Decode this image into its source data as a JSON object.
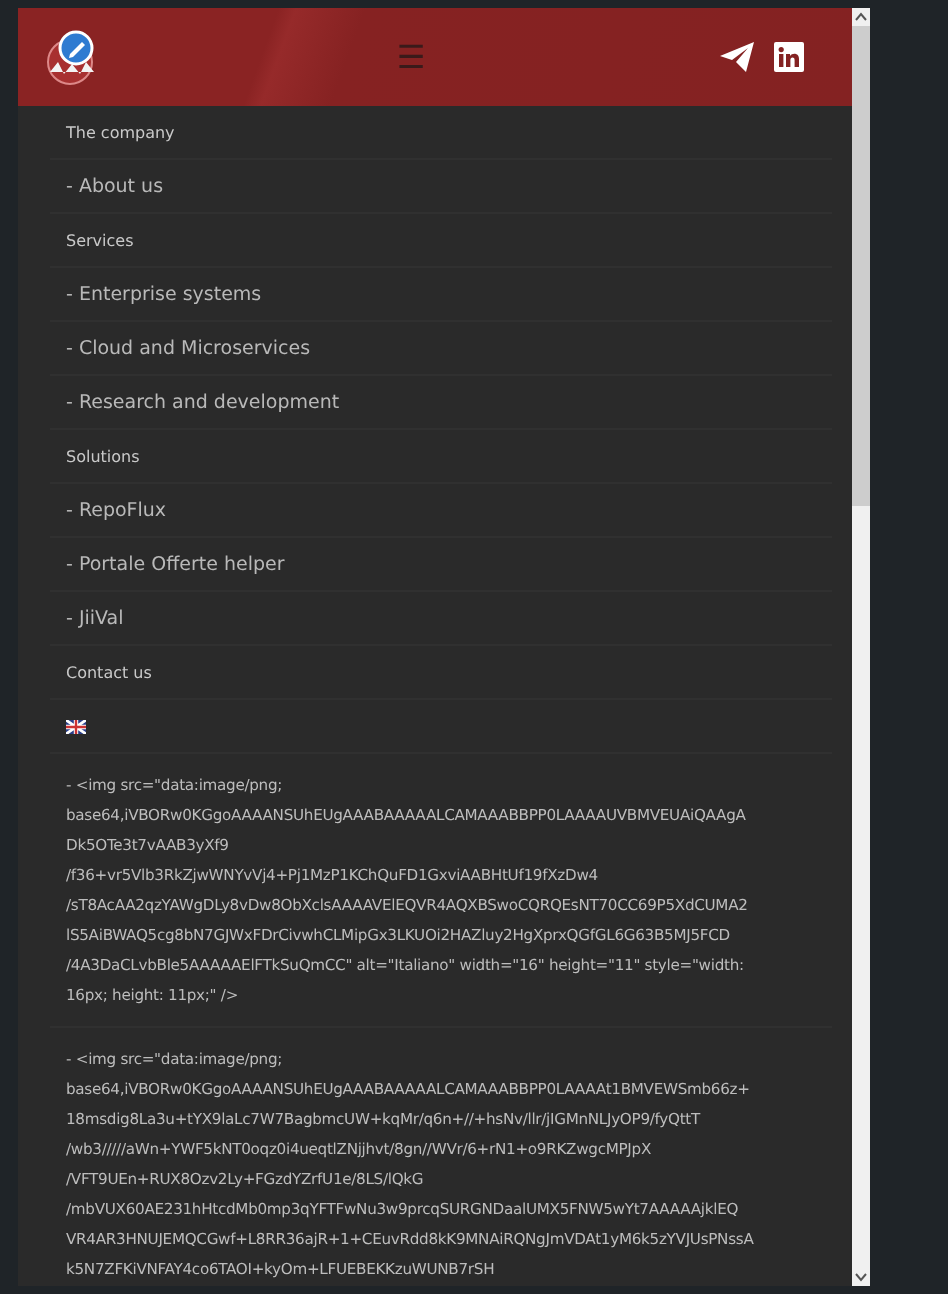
{
  "header": {
    "menu_icon": "☰"
  },
  "menu": [
    {
      "kind": "heading",
      "label": "The company"
    },
    {
      "kind": "link",
      "label": "- About us"
    },
    {
      "kind": "heading",
      "label": "Services"
    },
    {
      "kind": "link",
      "label": "- Enterprise systems"
    },
    {
      "kind": "link",
      "label": "- Cloud and Microservices"
    },
    {
      "kind": "link",
      "label": "- Research and development"
    },
    {
      "kind": "heading",
      "label": "Solutions"
    },
    {
      "kind": "link",
      "label": "- RepoFlux"
    },
    {
      "kind": "link",
      "label": "- Portale Offerte helper"
    },
    {
      "kind": "link",
      "label": "- JiiVal"
    },
    {
      "kind": "heading",
      "label": "Contact us"
    },
    {
      "kind": "flag"
    },
    {
      "kind": "code",
      "lines": [
        "- <img src=\"data:image/png;",
        "base64,iVBORw0KGgoAAAANSUhEUgAAABAAAAALCAMAAABBPP0LAAAAUVBMVEUAiQAAgA",
        "Dk5OTe3t7vAAB3yXf9",
        "/f36+vr5Vlb3RkZjwWNYvVj4+Pj1MzP1KChQuFD1GxviAABHtUf19fXzDw4",
        "/sT8AcAA2qzYAWgDLy8vDw8ObXclsAAAAVElEQVR4AQXBSwoCQRQEsNT70CC69P5XdCUMA2",
        "lS5AiBWAQ5cg8bN7GJWxFDrCivwhCLMipGx3LKUOi2HAZluy2HgXprxQGfGL6G63B5MJ5FCD",
        "/4A3DaCLvbBle5AAAAAElFTkSuQmCC\" alt=\"Italiano\" width=\"16\" height=\"11\" style=\"width:",
        "16px; height: 11px;\" />"
      ]
    },
    {
      "kind": "code",
      "lines": [
        "- <img src=\"data:image/png;",
        "base64,iVBORw0KGgoAAAANSUhEUgAAABAAAAALCAMAAABBPP0LAAAAt1BMVEWSmb66z+",
        "18msdig8La3u+tYX9laLc7W7BagbmcUW+kqMr/q6n+//+hsNv/llr/jIGMnNLJyOP9/fyQttT",
        "/wb3/////aWn+YWF5kNT0oqz0i4ueqtlZNjjhvt/8gn//WVr/6+rN1+o9RKZwgcMPJpX",
        "/VFT9UEn+RUX8Ozv2Ly+FGzdYZrfU1e/8LS/lQkG",
        "/mbVUX60AE231hHtcdMb0mp3qYFTFwNu3w9prcqSURGNDaalUMX5FNW5wYt7AAAAAjklEQ",
        "VR4AR3HNUJEMQCGwf+L8RR36ajR+1+CEuvRdd8kK9MNAiRQNgJmVDAt1yM6k5zYVJUsPNssA",
        "k5N7ZFKiVNFAY4co6TAOI+kyOm+LFUEBEKKzuWUNB7rSH"
      ]
    }
  ]
}
